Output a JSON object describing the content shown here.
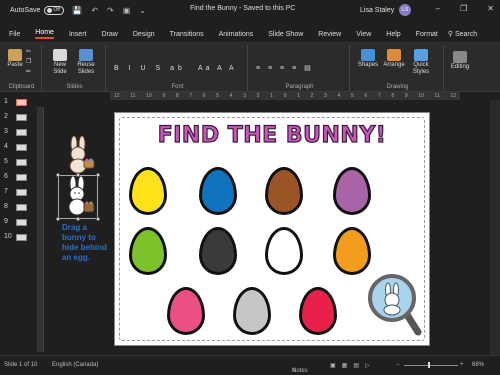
{
  "titlebar": {
    "autosave_label": "AutoSave",
    "autosave_state": "Off",
    "document_title": "Find the Bunny  -  Saved to this PC",
    "user_name": "Lisa Staley",
    "user_initials": "LS"
  },
  "menu": {
    "tabs": [
      "File",
      "Home",
      "Insert",
      "Draw",
      "Design",
      "Transitions",
      "Animations",
      "Slide Show",
      "Review",
      "View",
      "Help",
      "Format"
    ],
    "active": "Home",
    "search_label": "Search"
  },
  "ribbon": {
    "groups": {
      "clipboard": "Clipboard",
      "slides": "Slides",
      "font": "Font",
      "paragraph": "Paragraph",
      "drawing": "Drawing"
    },
    "paste_label": "Paste",
    "new_slide_label": "New Slide",
    "reuse_slides_label": "Reuse Slides",
    "shapes_label": "Shapes",
    "arrange_label": "Arrange",
    "quick_styles_label": "Quick Styles",
    "editing_label": "Editing"
  },
  "thumbnails": [
    "1",
    "2",
    "3",
    "4",
    "5",
    "6",
    "7",
    "8",
    "9",
    "10"
  ],
  "ruler_top": [
    "12",
    "11",
    "10",
    "9",
    "8",
    "7",
    "6",
    "5",
    "4",
    "3",
    "2",
    "1",
    "0",
    "1",
    "2",
    "3",
    "4",
    "5",
    "6",
    "7",
    "8",
    "9",
    "10",
    "11",
    "12"
  ],
  "slide": {
    "title": "FIND THE BUNNY!",
    "instruction": "Drag a bunny to hide behind an egg.",
    "eggs": [
      {
        "color": "#ffe219"
      },
      {
        "color": "#0f74bd"
      },
      {
        "color": "#9a5425"
      },
      {
        "color": "#a864a6"
      },
      {
        "color": "#7ec22b"
      },
      {
        "color": "#3a3a3a"
      },
      {
        "color": "#ffffff"
      },
      {
        "color": "#f39c1d"
      },
      {
        "color": "#ec4f86"
      },
      {
        "color": "#c6c6c6"
      },
      {
        "color": "#e8204a"
      }
    ]
  },
  "statusbar": {
    "slide_info": "Slide 1 of 10",
    "language": "English (Canada)",
    "notes_label": "Notes",
    "zoom": "68%"
  }
}
